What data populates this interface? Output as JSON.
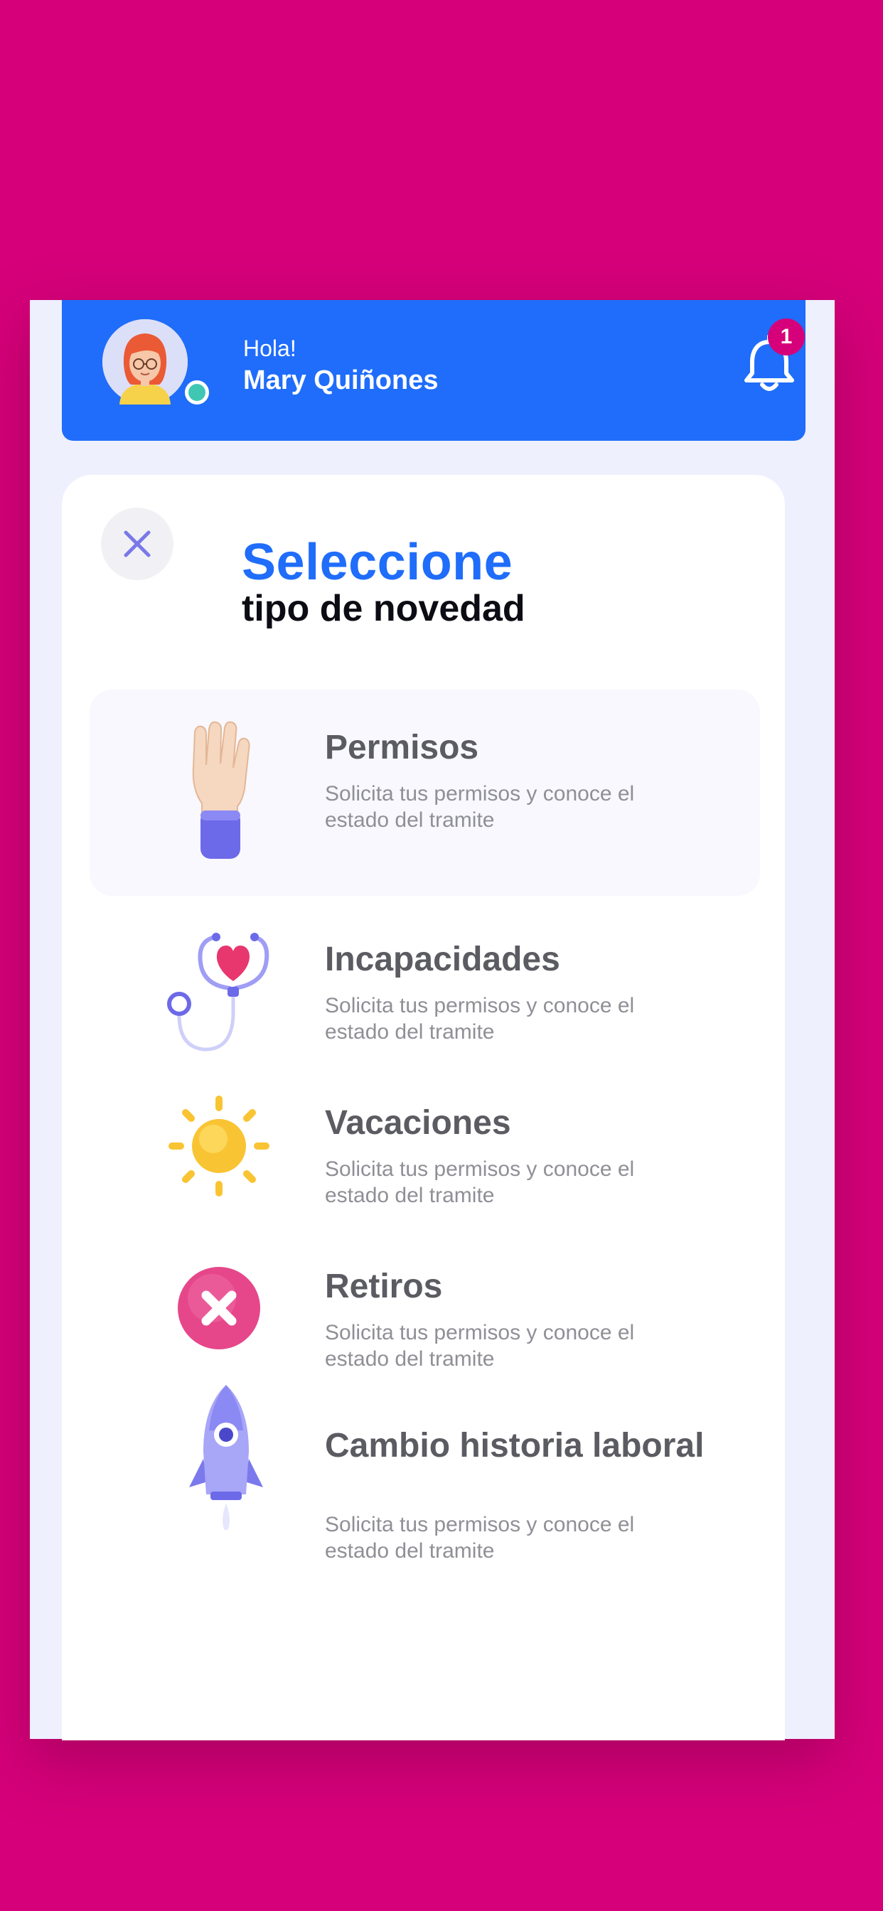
{
  "header": {
    "greeting": "Hola!",
    "user_name": "Mary Quiñones",
    "notifications_count": "1",
    "avatar_icon": "user-avatar",
    "bell_icon": "bell-icon"
  },
  "modal": {
    "close_icon": "close-icon",
    "title_line1": "Seleccione",
    "title_line2": "tipo de novedad"
  },
  "options": [
    {
      "name": "Permisos",
      "desc": "Solicita tus permisos y conoce el estado del tramite",
      "icon": "hand-icon",
      "selected": true
    },
    {
      "name": "Incapacidades",
      "desc": "Solicita tus permisos y conoce el estado del tramite",
      "icon": "stethoscope-icon",
      "selected": false
    },
    {
      "name": "Vacaciones",
      "desc": "Solicita tus permisos y conoce el estado del tramite",
      "icon": "sun-icon",
      "selected": false
    },
    {
      "name": "Retiros",
      "desc": "Solicita tus permisos y conoce el estado del tramite",
      "icon": "x-circle-icon",
      "selected": false
    },
    {
      "name": "Cambio historia laboral",
      "desc": "Solicita tus permisos y conoce el estado del tramite",
      "icon": "rocket-icon",
      "selected": false
    }
  ],
  "colors": {
    "background": "#d6007a",
    "primary": "#1f6dfa",
    "badge": "#d6007a",
    "online": "#3fc7b4"
  }
}
